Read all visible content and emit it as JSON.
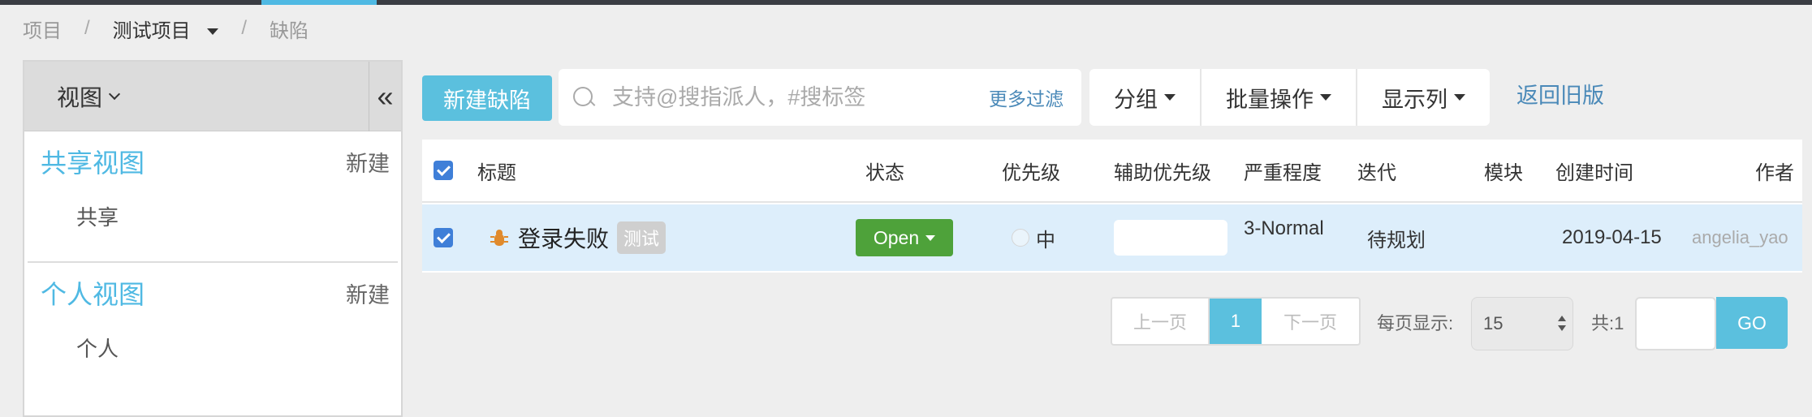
{
  "breadcrumb": {
    "root": "项目",
    "project": "测试项目",
    "current": "缺陷",
    "separator": "/"
  },
  "sidebar": {
    "view_toggle": "视图",
    "collapse_glyph": "«",
    "shared": {
      "title": "共享视图",
      "new_label": "新建",
      "items": [
        "共享"
      ]
    },
    "personal": {
      "title": "个人视图",
      "new_label": "新建",
      "items": [
        "个人"
      ]
    }
  },
  "toolbar": {
    "new_bug": "新建缺陷",
    "search_placeholder": "支持@搜指派人，#搜标签",
    "more_filter": "更多过滤",
    "group": "分组",
    "batch": "批量操作",
    "columns": "显示列",
    "back_old": "返回旧版"
  },
  "table": {
    "columns": [
      "标题",
      "状态",
      "优先级",
      "辅助优先级",
      "严重程度",
      "迭代",
      "模块",
      "创建时间",
      "作者"
    ],
    "rows": [
      {
        "title": "登录失败",
        "tag": "测试",
        "status": "Open",
        "priority": "中",
        "aux_priority": "",
        "severity": "3-Normal",
        "iteration": "待规划",
        "module": "",
        "created": "2019-04-15",
        "author": "angelia_yao"
      }
    ]
  },
  "pagination": {
    "prev": "上一页",
    "page": "1",
    "next": "下一页",
    "per_page_label": "每页显示:",
    "per_page_value": "15",
    "total_label": "共:1",
    "go": "GO"
  },
  "colors": {
    "accent": "#5bc0de",
    "status_open": "#4ea23a",
    "link": "#4a89b8",
    "bug_icon": "#e08a2c"
  }
}
